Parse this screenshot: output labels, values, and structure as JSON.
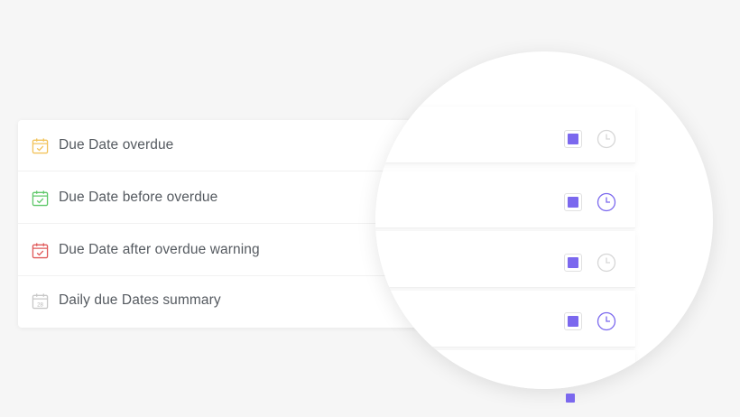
{
  "automations": {
    "items": [
      {
        "label": "Due Date overdue",
        "icon": "calendar-check-icon",
        "color": "#f2c35b"
      },
      {
        "label": "Due Date before overdue",
        "icon": "calendar-check-icon",
        "color": "#5fc86a"
      },
      {
        "label": "Due Date after overdue warning",
        "icon": "calendar-check-icon",
        "color": "#e05a5a"
      },
      {
        "label": "Daily due Dates summary",
        "icon": "calendar-28-icon",
        "color": "#c8c8c8",
        "day": "28"
      }
    ]
  },
  "magnifier": {
    "rows": [
      {
        "checkbox_checked": true,
        "clock_active": false
      },
      {
        "checkbox_checked": true,
        "clock_active": true
      },
      {
        "checkbox_checked": true,
        "clock_active": false
      },
      {
        "checkbox_checked": true,
        "clock_active": true
      }
    ]
  },
  "colors": {
    "accent": "#7b68ee",
    "inactive": "#d6d6d6",
    "text": "#555a60"
  }
}
